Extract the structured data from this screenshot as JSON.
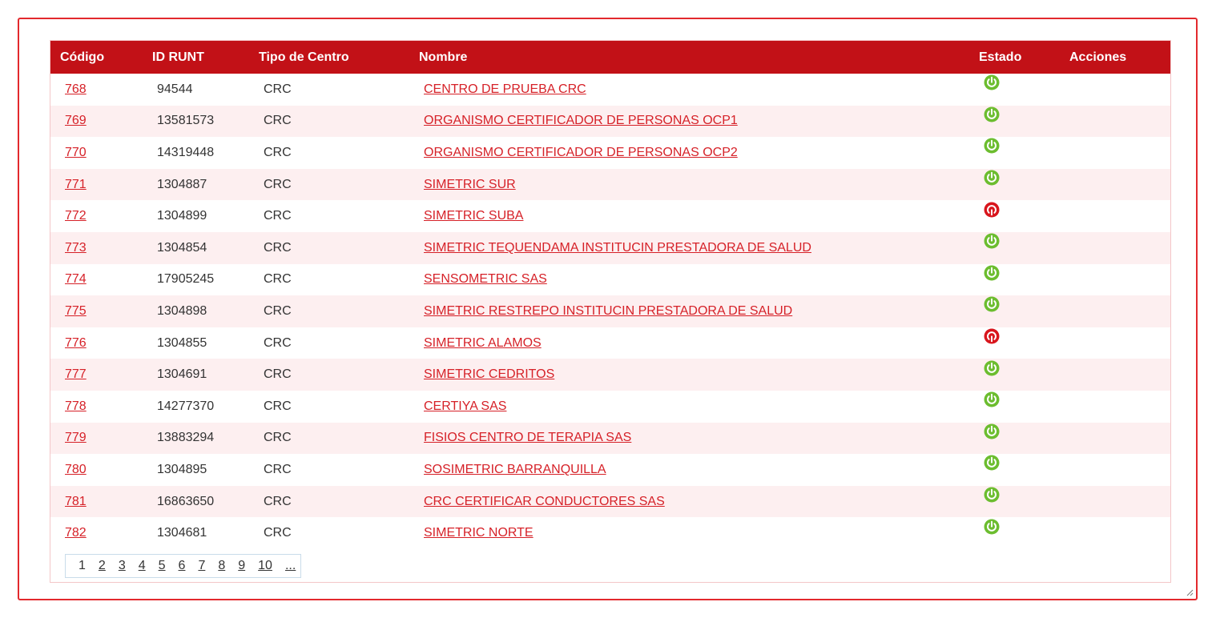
{
  "table": {
    "headers": [
      "Código",
      "ID RUNT",
      "Tipo de Centro",
      "Nombre",
      "Estado",
      "Acciones"
    ],
    "rows": [
      {
        "codigo": "768",
        "id_runt": "94544",
        "tipo": "CRC",
        "nombre": "CENTRO DE PRUEBA CRC",
        "estado": "active"
      },
      {
        "codigo": "769",
        "id_runt": "13581573",
        "tipo": "CRC",
        "nombre": "ORGANISMO CERTIFICADOR DE PERSONAS OCP1",
        "estado": "active"
      },
      {
        "codigo": "770",
        "id_runt": "14319448",
        "tipo": "CRC",
        "nombre": "ORGANISMO CERTIFICADOR DE PERSONAS OCP2",
        "estado": "active"
      },
      {
        "codigo": "771",
        "id_runt": "1304887",
        "tipo": "CRC",
        "nombre": "SIMETRIC SUR",
        "estado": "active"
      },
      {
        "codigo": "772",
        "id_runt": "1304899",
        "tipo": "CRC",
        "nombre": "SIMETRIC SUBA",
        "estado": "inactive"
      },
      {
        "codigo": "773",
        "id_runt": "1304854",
        "tipo": "CRC",
        "nombre": "SIMETRIC TEQUENDAMA INSTITUCIN PRESTADORA DE SALUD",
        "estado": "active"
      },
      {
        "codigo": "774",
        "id_runt": "17905245",
        "tipo": "CRC",
        "nombre": "SENSOMETRIC SAS",
        "estado": "active"
      },
      {
        "codigo": "775",
        "id_runt": "1304898",
        "tipo": "CRC",
        "nombre": "SIMETRIC RESTREPO INSTITUCIN PRESTADORA DE SALUD",
        "estado": "active"
      },
      {
        "codigo": "776",
        "id_runt": "1304855",
        "tipo": "CRC",
        "nombre": "SIMETRIC ALAMOS",
        "estado": "inactive"
      },
      {
        "codigo": "777",
        "id_runt": "1304691",
        "tipo": "CRC",
        "nombre": "SIMETRIC CEDRITOS",
        "estado": "active"
      },
      {
        "codigo": "778",
        "id_runt": "14277370",
        "tipo": "CRC",
        "nombre": "CERTIYA SAS",
        "estado": "active"
      },
      {
        "codigo": "779",
        "id_runt": "13883294",
        "tipo": "CRC",
        "nombre": "FISIOS CENTRO DE TERAPIA SAS",
        "estado": "active"
      },
      {
        "codigo": "780",
        "id_runt": "1304895",
        "tipo": "CRC",
        "nombre": "SOSIMETRIC BARRANQUILLA",
        "estado": "active"
      },
      {
        "codigo": "781",
        "id_runt": "16863650",
        "tipo": "CRC",
        "nombre": "CRC CERTIFICAR CONDUCTORES SAS",
        "estado": "active"
      },
      {
        "codigo": "782",
        "id_runt": "1304681",
        "tipo": "CRC",
        "nombre": "SIMETRIC NORTE",
        "estado": "active"
      }
    ]
  },
  "pager": {
    "current": "1",
    "pages": [
      "2",
      "3",
      "4",
      "5",
      "6",
      "7",
      "8",
      "9",
      "10",
      "..."
    ]
  },
  "icons": {
    "active": "power-on-icon",
    "inactive": "power-off-icon"
  },
  "colors": {
    "header_bg": "#c21117",
    "link": "#d62128",
    "row_alt": "#fdeff0",
    "frame_border": "#e3292d",
    "status_active": "#6cbd2f",
    "status_inactive": "#d8161d"
  }
}
